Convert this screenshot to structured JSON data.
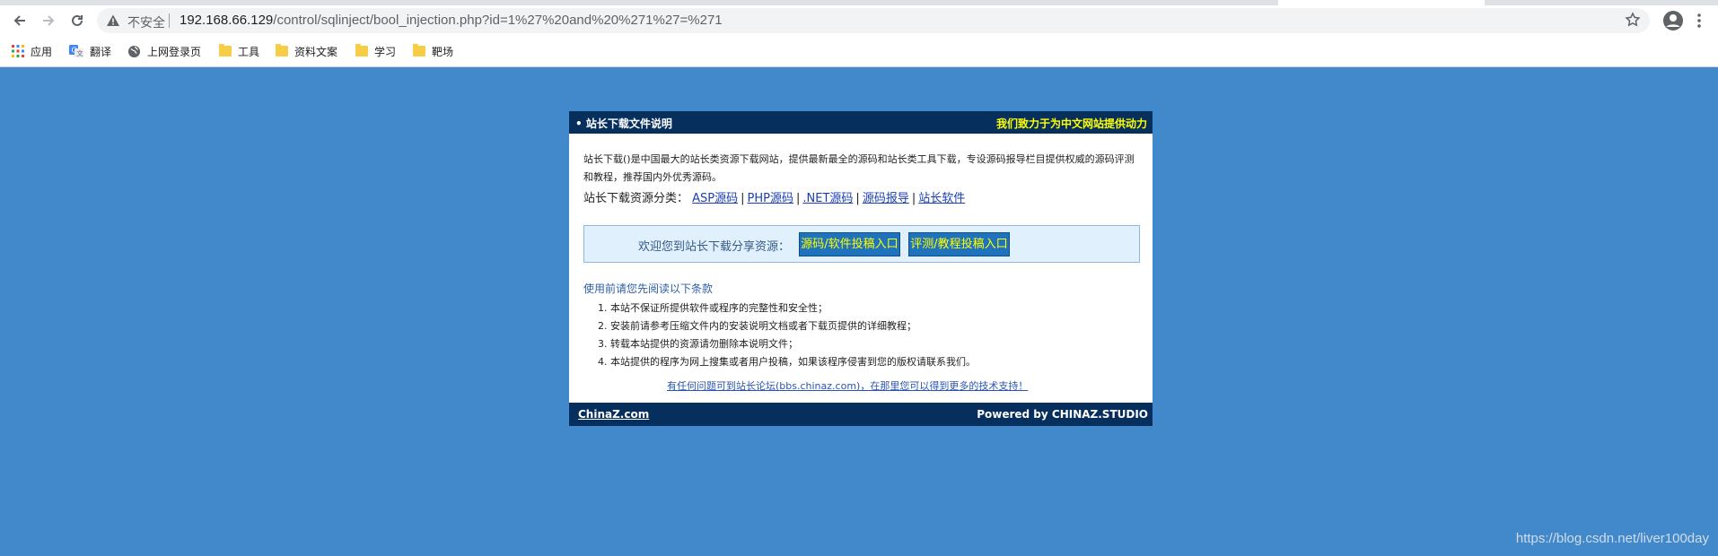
{
  "browser": {
    "omnibox": {
      "security_label": "不安全",
      "url_host": "192.168.66.129",
      "url_path": "/control/sqlinject/bool_injection.php?id=1%27%20and%20%271%27=%271"
    },
    "bookmarks": [
      {
        "label": "应用",
        "icon": "apps-grid-icon"
      },
      {
        "label": "翻译",
        "icon": "translate-icon"
      },
      {
        "label": "上网登录页",
        "icon": "globe-icon"
      },
      {
        "label": "工具",
        "icon": "folder-icon"
      },
      {
        "label": "资料文案",
        "icon": "folder-icon"
      },
      {
        "label": "学习",
        "icon": "folder-icon"
      },
      {
        "label": "靶场",
        "icon": "folder-icon"
      }
    ]
  },
  "page": {
    "header": {
      "title": "• 站长下载文件说明",
      "slogan": "我们致力于为中文网站提供动力"
    },
    "intro": "站长下载()是中国最大的站长类资源下载网站，提供最新最全的源码和站长类工具下载，专设源码报导栏目提供权威的源码评测和教程，推荐国内外优秀源码。",
    "categories": {
      "label": "站长下载资源分类：",
      "links": [
        "ASP源码",
        "PHP源码",
        ".NET源码",
        "源码报导",
        "站长软件"
      ]
    },
    "share": {
      "label": "欢迎您到站长下载分享资源：",
      "buttons": [
        "源码/软件投稿入口",
        "评测/教程投稿入口"
      ]
    },
    "terms": {
      "title": "使用前请您先阅读以下条款",
      "items": [
        {
          "num": "1.",
          "text": "本站不保证所提供软件或程序的完整性和安全性；"
        },
        {
          "num": "2.",
          "text": "安装前请参考压缩文件内的安装说明文档或者下载页提供的详细教程；"
        },
        {
          "num": "3.",
          "text": "转载本站提供的资源请勿删除本说明文件；"
        },
        {
          "num": "4.",
          "text": "本站提供的程序为网上搜集或者用户投稿，如果该程序侵害到您的版权请联系我们。"
        }
      ]
    },
    "forum_link": "有任何问题可到站长论坛(bbs.chinaz.com)，在那里您可以得到更多的技术支持！",
    "footer": {
      "left": "ChinaZ.com",
      "right": "Powered by CHINAZ.STUDIO"
    }
  },
  "watermark": "https://blog.csdn.net/liver100day",
  "colors": {
    "page_background": "#4289cb",
    "header_background": "#062f5e",
    "slogan": "#ffff00",
    "link": "#1a3eb5",
    "share_button": "#1f73bc"
  }
}
